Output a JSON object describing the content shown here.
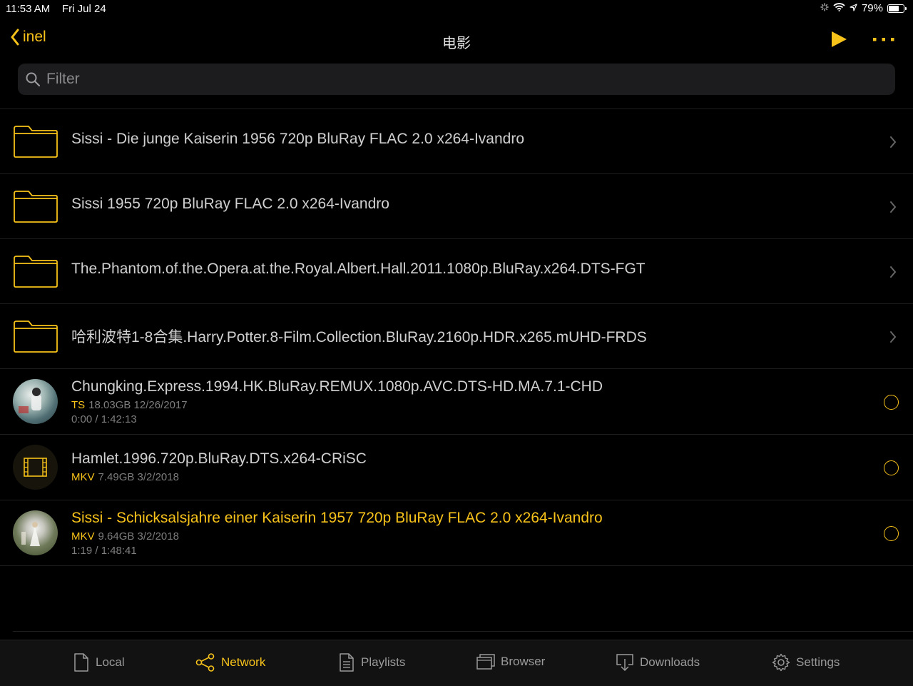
{
  "status": {
    "time": "11:53 AM",
    "date": "Fri Jul 24",
    "battery": "79%",
    "battery_level": 0.79
  },
  "nav": {
    "back_label": "inel",
    "title": "电影"
  },
  "search": {
    "placeholder": "Filter"
  },
  "folders": [
    {
      "name": "Sissi - Die junge Kaiserin 1956 720p BluRay FLAC 2.0 x264-Ivandro"
    },
    {
      "name": "Sissi 1955 720p BluRay FLAC 2.0 x264-Ivandro"
    },
    {
      "name": "The.Phantom.of.the.Opera.at.the.Royal.Albert.Hall.2011.1080p.BluRay.x264.DTS-FGT"
    },
    {
      "name": "哈利波特1-8合集.Harry.Potter.8-Film.Collection.BluRay.2160p.HDR.x265.mUHD-FRDS"
    }
  ],
  "files": [
    {
      "name": "Chungking.Express.1994.HK.BluRay.REMUX.1080p.AVC.DTS-HD.MA.7.1-CHD",
      "format": "TS",
      "info": "18.03GB 12/26/2017",
      "progress": "0:00 / 1:42:13",
      "thumb": "photo",
      "active": false
    },
    {
      "name": "Hamlet.1996.720p.BluRay.DTS.x264-CRiSC",
      "format": "MKV",
      "info": "7.49GB 3/2/2018",
      "progress": "",
      "thumb": "film-icon",
      "active": false
    },
    {
      "name": "Sissi - Schicksalsjahre einer Kaiserin 1957 720p BluRay FLAC 2.0 x264-Ivandro",
      "format": "MKV",
      "info": "9.64GB 3/2/2018",
      "progress": "1:19 / 1:48:41",
      "thumb": "photo",
      "active": true
    }
  ],
  "tabs": [
    {
      "label": "Local",
      "icon": "document-icon"
    },
    {
      "label": "Network",
      "icon": "share-icon",
      "active": true
    },
    {
      "label": "Playlists",
      "icon": "list-document-icon"
    },
    {
      "label": "Browser",
      "icon": "windows-icon"
    },
    {
      "label": "Downloads",
      "icon": "download-icon"
    },
    {
      "label": "Settings",
      "icon": "gear-icon"
    }
  ],
  "colors": {
    "accent": "#f7c21a",
    "background": "#000000",
    "search_bg": "#1c1c1e"
  }
}
